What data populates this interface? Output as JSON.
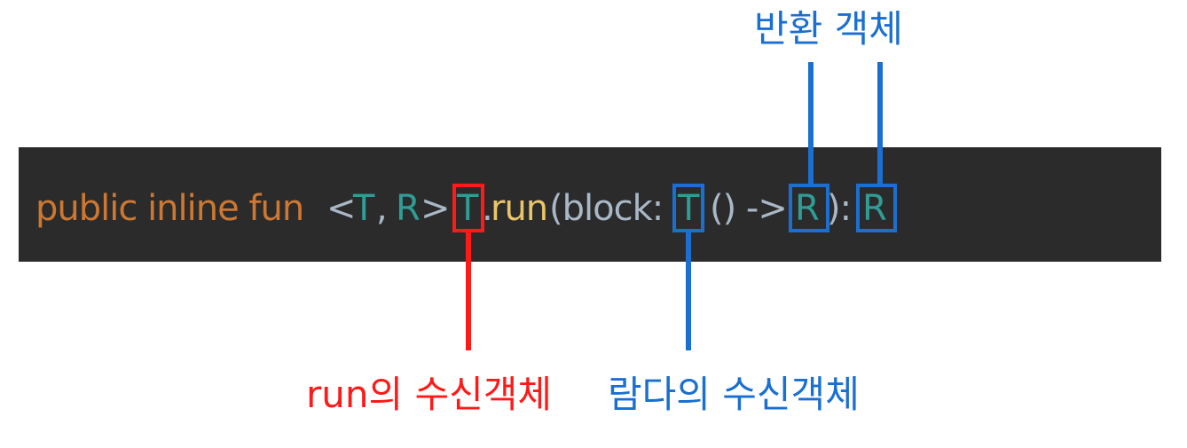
{
  "code": {
    "t1": "public inline fun",
    "t2": "<",
    "t3": "T",
    "t4": ",",
    "t5": "R",
    "t6": ">",
    "t7": "T",
    "t8": ".",
    "t9": "run",
    "t10": "(block:",
    "t11": "T",
    "t12": "() ->",
    "t13": "R",
    "t14": "):",
    "t15": "R"
  },
  "labels": {
    "return_object": "반환 객체",
    "run_receiver": "run의 수신객체",
    "lambda_receiver": "람다의 수신객체"
  },
  "colors": {
    "background": "#2b2b2b",
    "keyword": "#cc7832",
    "type_param": "#2f9c95",
    "plain": "#a9b7c6",
    "function": "#e8c46a",
    "blue_annotation": "#1a6fd0",
    "red_annotation": "#ff1a1a"
  }
}
